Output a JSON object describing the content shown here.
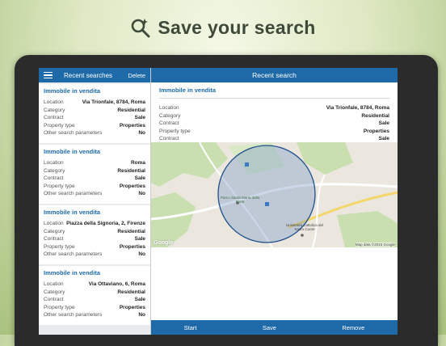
{
  "headline": {
    "text": "Save your search"
  },
  "left_panel": {
    "title": "Recent searches",
    "delete_label": "Delete",
    "cards": [
      {
        "title": "Immobile in vendita",
        "rows": [
          {
            "key": "Location",
            "value": "Via Trionfale, 8784, Roma"
          },
          {
            "key": "Category",
            "value": "Residential"
          },
          {
            "key": "Contract",
            "value": "Sale"
          },
          {
            "key": "Property type",
            "value": "Properties"
          },
          {
            "key": "Other search parameters",
            "value": "No"
          }
        ]
      },
      {
        "title": "Immobile in vendita",
        "rows": [
          {
            "key": "Location",
            "value": "Roma"
          },
          {
            "key": "Category",
            "value": "Residential"
          },
          {
            "key": "Contract",
            "value": "Sale"
          },
          {
            "key": "Property type",
            "value": "Properties"
          },
          {
            "key": "Other search parameters",
            "value": "No"
          }
        ]
      },
      {
        "title": "Immobile in vendita",
        "rows": [
          {
            "key": "Location",
            "value": "Piazza della Signoria, 2, Firenze"
          },
          {
            "key": "Category",
            "value": "Residential"
          },
          {
            "key": "Contract",
            "value": "Sale"
          },
          {
            "key": "Property type",
            "value": "Properties"
          },
          {
            "key": "Other search parameters",
            "value": "No"
          }
        ]
      },
      {
        "title": "Immobile in vendita",
        "rows": [
          {
            "key": "Location",
            "value": "Via Ottaviano, 6, Roma"
          },
          {
            "key": "Category",
            "value": "Residential"
          },
          {
            "key": "Contract",
            "value": "Sale"
          },
          {
            "key": "Property type",
            "value": "Properties"
          },
          {
            "key": "Other search parameters",
            "value": "No"
          }
        ]
      }
    ]
  },
  "right_panel": {
    "title": "Recent search",
    "detail": {
      "title": "Immobile in vendita",
      "rows": [
        {
          "key": "Location",
          "value": "Via Trionfale, 8784, Roma"
        },
        {
          "key": "Category",
          "value": "Residential"
        },
        {
          "key": "Contract",
          "value": "Sale"
        },
        {
          "key": "Property type",
          "value": "Properties"
        },
        {
          "key": "Contract",
          "value": "Sale"
        }
      ]
    },
    "map": {
      "label_park": "Parco Santa Maria della Pietà",
      "label_univ": "Università Cattolica del Sacro Cuore",
      "google_logo": "Google",
      "attribution": "Map data ©2015 Google",
      "colors": {
        "land": "#ebe7df",
        "park": "#c9dfb0",
        "circle": "#6d93c7",
        "road": "#f5d66b"
      }
    },
    "actions": {
      "start": "Start",
      "save": "Save",
      "remove": "Remove"
    }
  },
  "colors": {
    "accent": "#1e6aa8",
    "background": "#dfe9c4",
    "tablet_frame": "#2b2b2b"
  }
}
